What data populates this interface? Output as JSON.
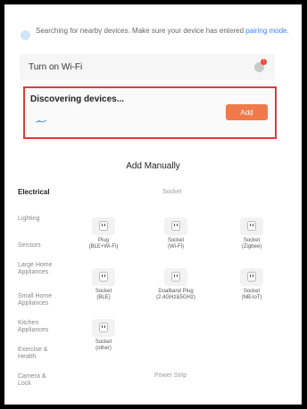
{
  "scan": {
    "text": "Searching for nearby devices. Make sure your device has entered",
    "link": "pairing mode",
    "tail": "."
  },
  "wifi": {
    "label": "Turn on Wi-Fi",
    "badge": "!"
  },
  "discover": {
    "title": "Discovering devices...",
    "add_label": "Add"
  },
  "manual": {
    "title": "Add Manually"
  },
  "categories": [
    {
      "label": "Electrical"
    },
    {
      "label": "Lighting"
    },
    {
      "label": "Sensors"
    },
    {
      "label": "Large Home Appliances"
    },
    {
      "label": "Small Home Appliances"
    },
    {
      "label": "Kitchen Appliances"
    },
    {
      "label": "Exercise & Health"
    },
    {
      "label": "Camera & Lock"
    }
  ],
  "sections": [
    {
      "label": "Socket"
    },
    {
      "label": "Power Strip"
    }
  ],
  "devices": [
    {
      "l1": "Plug",
      "l2": "(BLE+Wi-Fi)"
    },
    {
      "l1": "Socket",
      "l2": "(Wi-Fi)"
    },
    {
      "l1": "Socket",
      "l2": "(Zigbee)"
    },
    {
      "l1": "Socket",
      "l2": "(BLE)"
    },
    {
      "l1": "Dualband Plug",
      "l2": "(2.4GHz&5GHz)"
    },
    {
      "l1": "Socket",
      "l2": "(NB-IoT)"
    },
    {
      "l1": "Socket",
      "l2": "(other)"
    }
  ],
  "colors": {
    "accent": "#f07a4a",
    "highlight": "#e03a3a",
    "link": "#3b82f6"
  }
}
